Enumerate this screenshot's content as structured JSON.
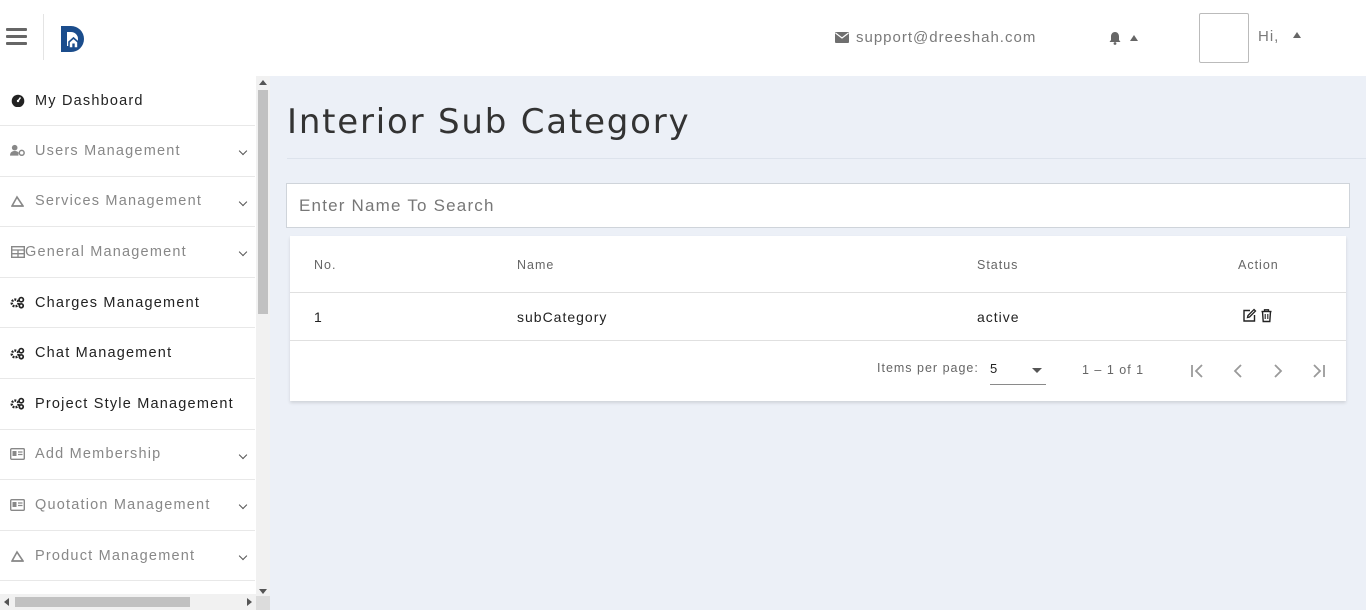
{
  "header": {
    "support_email": "support@dreeshah.com",
    "greeting": "Hi,"
  },
  "sidebar": {
    "items": [
      {
        "label": "My Dashboard",
        "icon": "dashboard-icon",
        "has_submenu": false
      },
      {
        "label": "Users Management",
        "icon": "users-cog-icon",
        "has_submenu": true
      },
      {
        "label": "Services Management",
        "icon": "drafting-icon",
        "has_submenu": true
      },
      {
        "label": "General Management",
        "icon": "table-icon",
        "has_submenu": true
      },
      {
        "label": "Charges Management",
        "icon": "cogs-icon",
        "has_submenu": false
      },
      {
        "label": "Chat Management",
        "icon": "cogs-icon",
        "has_submenu": false
      },
      {
        "label": "Project Style Management",
        "icon": "cogs-icon",
        "has_submenu": false
      },
      {
        "label": "Add Membership",
        "icon": "id-card-icon",
        "has_submenu": true
      },
      {
        "label": "Quotation Management",
        "icon": "id-card-icon",
        "has_submenu": true
      },
      {
        "label": "Product Management",
        "icon": "drafting-icon",
        "has_submenu": true
      }
    ]
  },
  "main": {
    "title": "Interior Sub Category",
    "search_placeholder": "Enter Name To Search",
    "table": {
      "columns": [
        "No.",
        "Name",
        "Status",
        "Action"
      ],
      "rows": [
        {
          "no": "1",
          "name": "subCategory",
          "status": "active"
        }
      ]
    },
    "paginator": {
      "items_per_page_label": "Items per page:",
      "items_per_page_value": "5",
      "range_label": "1 – 1 of 1"
    }
  },
  "colors": {
    "page_background": "#ecf0f7",
    "logo_blue": "#1b4d8c"
  }
}
